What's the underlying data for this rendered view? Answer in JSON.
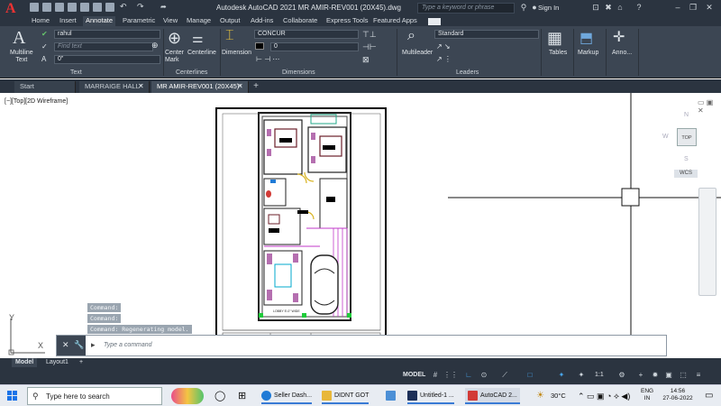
{
  "app": {
    "title": "Autodesk AutoCAD 2021   MR AMIR-REV001 (20X45).dwg",
    "search_placeholder": "Type a keyword or phrase",
    "sign_in": "Sign In"
  },
  "menu": {
    "tabs": [
      "Home",
      "Insert",
      "Annotate",
      "Parametric",
      "View",
      "Manage",
      "Output",
      "Add-ins",
      "Collaborate",
      "Express Tools",
      "Featured Apps"
    ],
    "active": "Annotate"
  },
  "ribbon": {
    "multiline_text": "Multiline\nText",
    "text_style": "rahul",
    "find_text": "Find text",
    "text_height": "0\"",
    "text_panel": "Text",
    "center_mark": "Center\nMark",
    "centerline": "Centerline",
    "centerlines_panel": "Centerlines",
    "dimension": "Dimension",
    "dim_style": "CONCUR",
    "dim_layer": "0",
    "dimensions_panel": "Dimensions",
    "multileader": "Multileader",
    "leader_style": "Standard",
    "leaders_panel": "Leaders",
    "tables": "Tables",
    "markup": "Markup",
    "annotate_more": "Anno..."
  },
  "doc_tabs": [
    {
      "label": "Start",
      "active": false
    },
    {
      "label": "MARRAIGE HALL*",
      "active": false
    },
    {
      "label": "MR AMIR-REV001 (20X45)*",
      "active": true
    }
  ],
  "canvas": {
    "viewport_label": "[−][Top][2D Wireframe]",
    "viewcube_top": "TOP",
    "viewcube_n": "N",
    "viewcube_s": "S",
    "viewcube_w": "W",
    "wcs": "WCS",
    "ucs_y": "Y",
    "ucs_x": "X",
    "drawing_note": "LOBBY 5'-0\" WIDE"
  },
  "command": {
    "history": [
      "Command:",
      "Command:",
      "Command: Regenerating model."
    ],
    "placeholder": "Type a command"
  },
  "layouts": [
    {
      "label": "Model",
      "active": true
    },
    {
      "label": "Layout1",
      "active": false
    }
  ],
  "status": {
    "model": "MODEL",
    "scale": "1:1"
  },
  "taskbar": {
    "search": "Type here to search",
    "apps": [
      {
        "label": "Seller Dash...",
        "color": "#1f7ad6"
      },
      {
        "label": "DIDNT GOT",
        "color": "#e8b73a"
      },
      {
        "label": "Untitled-1 ...",
        "color": "#1c2f58"
      },
      {
        "label": "AutoCAD 2...",
        "color": "#d23a36"
      }
    ],
    "temperature": "30°C",
    "lang_1": "ENG",
    "lang_2": "IN",
    "time": "14:56",
    "date": "27-06-2022"
  },
  "colors": {
    "chrome_dark": "#2b3440",
    "ribbon": "#3c4653",
    "accent": "#48a7f0",
    "autocad_red": "#d23a36"
  }
}
